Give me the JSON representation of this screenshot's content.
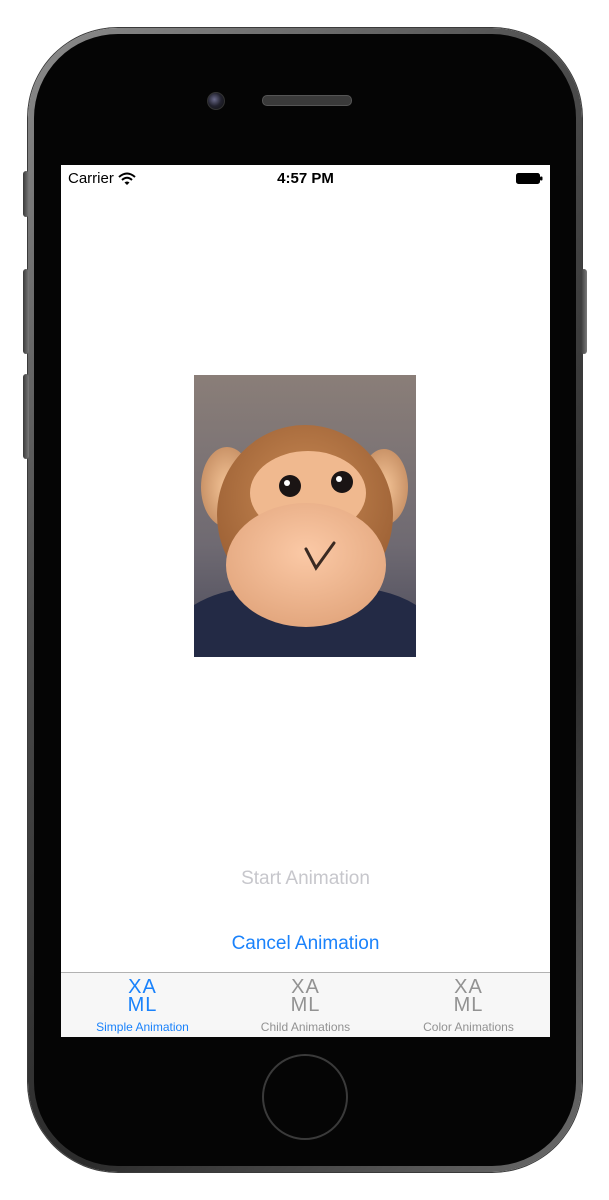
{
  "status_bar": {
    "carrier": "Carrier",
    "time": "4:57 PM"
  },
  "main": {
    "image_subject": "plush monkey face",
    "start_button_label": "Start Animation",
    "cancel_button_label": "Cancel Animation"
  },
  "tab_bar": {
    "tabs": [
      {
        "icon_top": "XA",
        "icon_bottom": "ML",
        "label": "Simple Animation",
        "active": true
      },
      {
        "icon_top": "XA",
        "icon_bottom": "ML",
        "label": "Child Animations",
        "active": false
      },
      {
        "icon_top": "XA",
        "icon_bottom": "ML",
        "label": "Color Animations",
        "active": false
      }
    ]
  },
  "colors": {
    "accent": "#1a82fb",
    "disabled_text": "#c7c7cc",
    "inactive_tab": "#929292"
  }
}
